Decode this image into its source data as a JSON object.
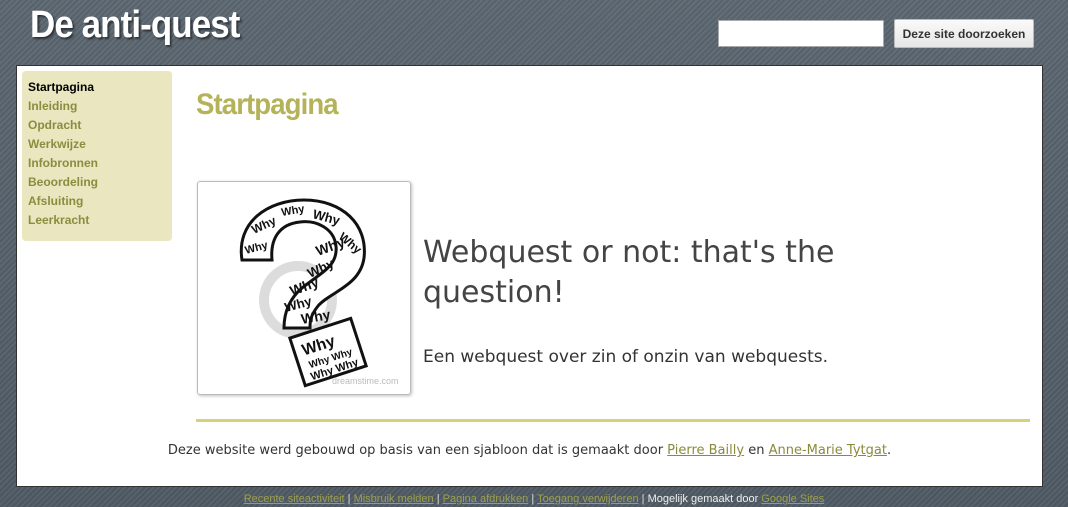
{
  "header": {
    "site_title": "De anti-quest",
    "search_placeholder": "",
    "search_button": "Deze site doorzoeken"
  },
  "sidebar": {
    "items": [
      {
        "label": "Startpagina",
        "active": true
      },
      {
        "label": "Inleiding"
      },
      {
        "label": "Opdracht"
      },
      {
        "label": "Werkwijze"
      },
      {
        "label": "Infobronnen"
      },
      {
        "label": "Beoordeling"
      },
      {
        "label": "Afsluiting"
      },
      {
        "label": "Leerkracht"
      }
    ]
  },
  "main": {
    "page_title": "Startpagina",
    "heading": "Webquest or not: that's the question!",
    "subtitle": "Een webquest over zin of onzin van webquests.",
    "image": {
      "alt": "question mark made of Why",
      "watermark": "dreamstime.com"
    },
    "credit": {
      "prefix": "Deze website werd gebouwd op basis van een sjabloon dat is gemaakt door ",
      "author1": "Pierre Bailly",
      "middle": " en ",
      "author2": "Anne-Marie Tytgat",
      "suffix": "."
    }
  },
  "footer": {
    "links": [
      "Recente siteactiviteit",
      "Misbruik melden",
      "Pagina afdrukken",
      "Toegang verwijderen"
    ],
    "powered_text": "Mogelijk gemaakt door",
    "powered_link": "Google Sites"
  },
  "colors": {
    "accent": "#b5b35a",
    "sidebar_bg": "#e9e6c0",
    "link": "#8b8d3e",
    "background": "#56616b"
  }
}
